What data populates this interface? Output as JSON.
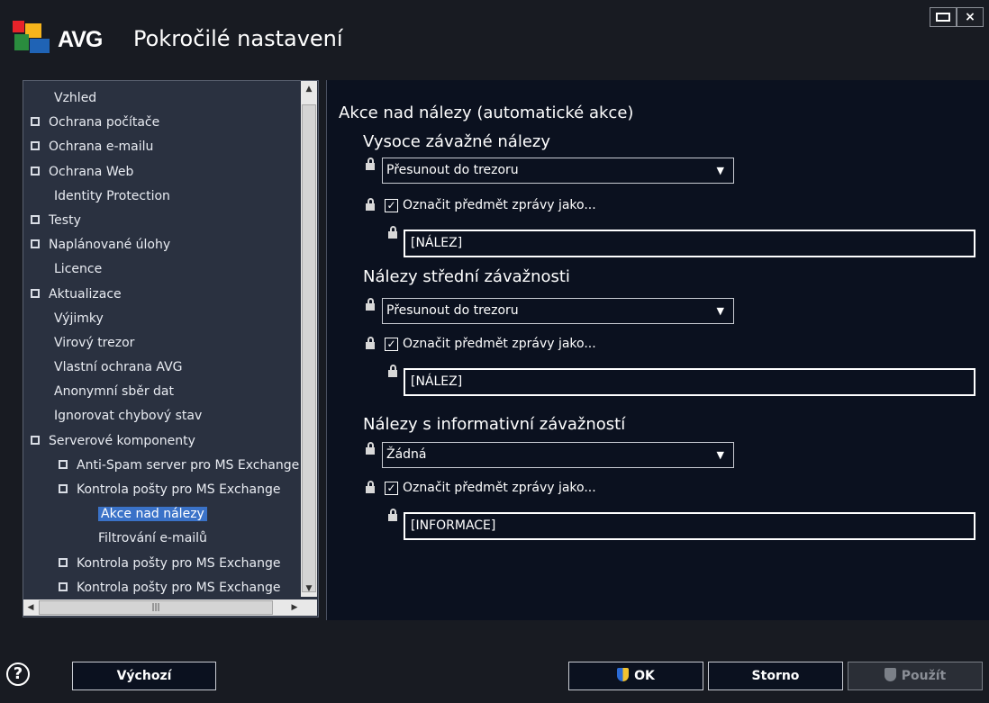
{
  "window": {
    "brand": "AVG",
    "title": "Pokročilé nastavení",
    "close_glyph": "×",
    "brand_colors": [
      "#e8232a",
      "#f6b41b",
      "#2a8c3e",
      "#1f63b5"
    ]
  },
  "tree": {
    "items": [
      {
        "label": "Vzhled",
        "indent": 0,
        "expander": false,
        "selected": false
      },
      {
        "label": "Ochrana počítače",
        "indent": 0,
        "expander": true,
        "selected": false
      },
      {
        "label": "Ochrana e-mailu",
        "indent": 0,
        "expander": true,
        "selected": false
      },
      {
        "label": "Ochrana Web",
        "indent": 0,
        "expander": true,
        "selected": false
      },
      {
        "label": "Identity Protection",
        "indent": 0,
        "expander": false,
        "selected": false
      },
      {
        "label": "Testy",
        "indent": 0,
        "expander": true,
        "selected": false
      },
      {
        "label": "Naplánované úlohy",
        "indent": 0,
        "expander": true,
        "selected": false
      },
      {
        "label": "Licence",
        "indent": 0,
        "expander": false,
        "selected": false
      },
      {
        "label": "Aktualizace",
        "indent": 0,
        "expander": true,
        "selected": false
      },
      {
        "label": "Výjimky",
        "indent": 0,
        "expander": false,
        "selected": false
      },
      {
        "label": "Virový trezor",
        "indent": 0,
        "expander": false,
        "selected": false
      },
      {
        "label": "Vlastní ochrana AVG",
        "indent": 0,
        "expander": false,
        "selected": false
      },
      {
        "label": "Anonymní sběr dat",
        "indent": 0,
        "expander": false,
        "selected": false
      },
      {
        "label": "Ignorovat chybový stav",
        "indent": 0,
        "expander": false,
        "selected": false
      },
      {
        "label": "Serverové komponenty",
        "indent": 0,
        "expander": true,
        "selected": false
      },
      {
        "label": "Anti-Spam server pro MS Exchange",
        "indent": 1,
        "expander": true,
        "selected": false
      },
      {
        "label": "Kontrola pošty pro MS Exchange",
        "indent": 1,
        "expander": true,
        "selected": false
      },
      {
        "label": "Akce nad nálezy",
        "indent": 2,
        "expander": false,
        "selected": true
      },
      {
        "label": "Filtrování e-mailů",
        "indent": 2,
        "expander": false,
        "selected": false
      },
      {
        "label": "Kontrola pošty pro MS Exchange",
        "indent": 1,
        "expander": true,
        "selected": false
      },
      {
        "label": "Kontrola pošty pro MS Exchange",
        "indent": 1,
        "expander": true,
        "selected": false
      }
    ]
  },
  "panel": {
    "title": "Akce nad nálezy (automatické akce)",
    "sections": [
      {
        "heading": "Vysoce závažné nálezy",
        "action": "Přesunout do trezoru",
        "checkbox_label": "Označit předmět zprávy jako...",
        "checked": true,
        "tag": "[NÁLEZ]"
      },
      {
        "heading": "Nálezy střední závažnosti",
        "action": "Přesunout do trezoru",
        "checkbox_label": "Označit předmět zprávy jako...",
        "checked": true,
        "tag": "[NÁLEZ]"
      },
      {
        "heading": "Nálezy s informativní závažností",
        "action": "Žádná",
        "checkbox_label": "Označit předmět zprávy jako...",
        "checked": true,
        "tag": "[INFORMACE]"
      }
    ]
  },
  "footer": {
    "help_glyph": "?",
    "default_label": "Výchozí",
    "ok_label": "OK",
    "cancel_label": "Storno",
    "apply_label": "Použít"
  }
}
